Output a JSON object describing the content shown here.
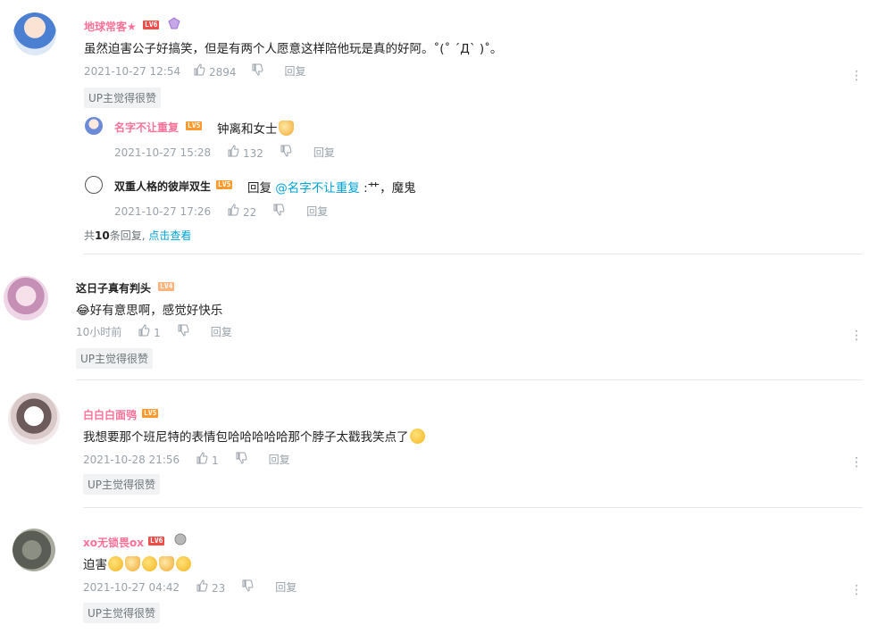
{
  "comments": [
    {
      "username": "地球常客★",
      "level": "LV6",
      "text": "虽然迫害公子好搞笑，但是有两个人愿意这样陪他玩是真的好阿。˚(˚ ˊДˋ )˚。",
      "time": "2021-10-27 12:54",
      "likes": "2894",
      "reply_label": "回复",
      "up_tag": "UP主觉得很赞",
      "replies": [
        {
          "username": "名字不让重复",
          "level": "LV5",
          "text": "钟离和女士",
          "time": "2021-10-27 15:28",
          "likes": "132",
          "reply_label": "回复"
        },
        {
          "username": "双重人格的彼岸双生",
          "level": "LV5",
          "reply_prefix": "回复",
          "mention": "@名字不让重复",
          "text": ":艹，魔鬼",
          "time": "2021-10-27 17:26",
          "likes": "22",
          "reply_label": "回复"
        }
      ],
      "view_more": {
        "prefix": "共",
        "count": "10",
        "suffix": "条回复,",
        "link": "点击查看"
      }
    },
    {
      "username": "这日子真有判头",
      "level": "LV4",
      "text": "😂好有意思啊，感觉好快乐",
      "time": "10小时前",
      "likes": "1",
      "reply_label": "回复",
      "up_tag": "UP主觉得很赞"
    },
    {
      "username": "白白白面鸮",
      "level": "LV5",
      "text": "我想要那个班尼特的表情包哈哈哈哈哈那个脖子太戳我笑点了",
      "time": "2021-10-28 21:56",
      "likes": "1",
      "reply_label": "回复",
      "up_tag": "UP主觉得很赞"
    },
    {
      "username": "xo无锁畏ox",
      "level": "LV6",
      "text": "迫害",
      "time": "2021-10-27 04:42",
      "likes": "23",
      "reply_label": "回复",
      "up_tag": "UP主觉得很赞"
    }
  ],
  "icons": {
    "like": "thumbs-up-icon",
    "dislike": "thumbs-down-icon",
    "more": "more-vertical-icon"
  },
  "colors": {
    "username_pink": "#fb7299",
    "link_blue": "#00a1d6",
    "meta_gray": "#99a2aa"
  }
}
